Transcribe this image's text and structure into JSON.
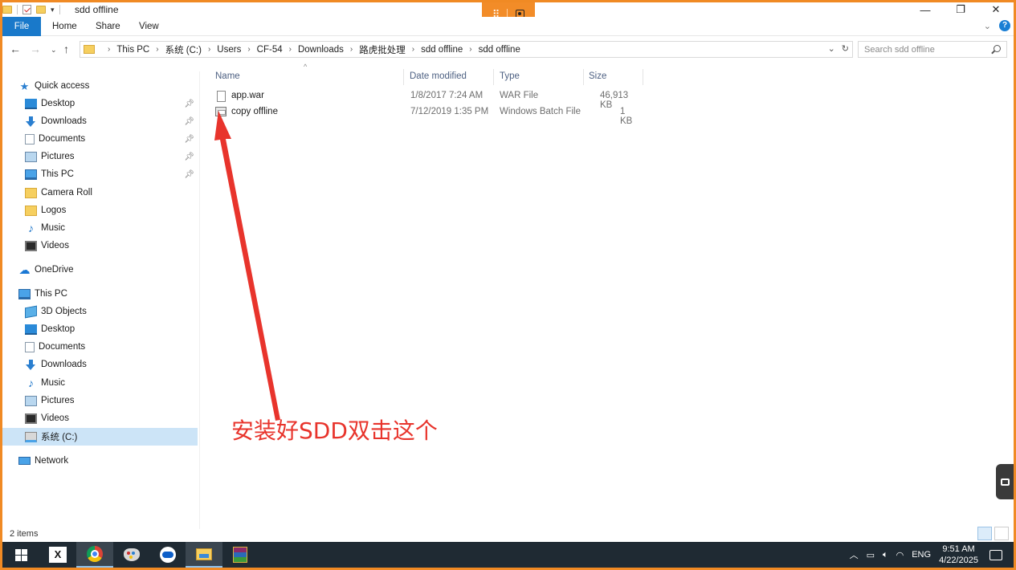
{
  "window": {
    "title": "sdd offline"
  },
  "ribbon": {
    "tabs": [
      "File",
      "Home",
      "Share",
      "View"
    ]
  },
  "address": {
    "breadcrumbs": [
      "This PC",
      "系统 (C:)",
      "Users",
      "CF-54",
      "Downloads",
      "路虎批处理",
      "sdd offline",
      "sdd offline"
    ],
    "search_placeholder": "Search sdd offline"
  },
  "nav": {
    "items": [
      {
        "label": "Quick access",
        "icon": "star-icon",
        "pinned": false
      },
      {
        "label": "Desktop",
        "icon": "desktop-icon",
        "pinned": true
      },
      {
        "label": "Downloads",
        "icon": "download-icon",
        "pinned": true
      },
      {
        "label": "Documents",
        "icon": "document-icon",
        "pinned": true
      },
      {
        "label": "Pictures",
        "icon": "pictures-icon",
        "pinned": true
      },
      {
        "label": "This PC",
        "icon": "pc-icon",
        "pinned": true
      },
      {
        "label": "Camera Roll",
        "icon": "folder-icon",
        "pinned": false
      },
      {
        "label": "Logos",
        "icon": "folder-icon",
        "pinned": false
      },
      {
        "label": "Music",
        "icon": "music-icon",
        "pinned": false
      },
      {
        "label": "Videos",
        "icon": "video-icon",
        "pinned": false
      },
      {
        "label": "OneDrive",
        "icon": "cloud-icon",
        "pinned": false
      },
      {
        "label": "This PC",
        "icon": "pc-icon",
        "pinned": false
      },
      {
        "label": "3D Objects",
        "icon": "3d-objects-icon",
        "pinned": false
      },
      {
        "label": "Desktop",
        "icon": "desktop-icon",
        "pinned": false
      },
      {
        "label": "Documents",
        "icon": "document-icon",
        "pinned": false
      },
      {
        "label": "Downloads",
        "icon": "download-icon",
        "pinned": false
      },
      {
        "label": "Music",
        "icon": "music-icon",
        "pinned": false
      },
      {
        "label": "Pictures",
        "icon": "pictures-icon",
        "pinned": false
      },
      {
        "label": "Videos",
        "icon": "video-icon",
        "pinned": false
      },
      {
        "label": "系统 (C:)",
        "icon": "drive-icon",
        "pinned": false,
        "selected": true
      },
      {
        "label": "Network",
        "icon": "network-icon",
        "pinned": false
      }
    ]
  },
  "files": {
    "columns": [
      "Name",
      "Date modified",
      "Type",
      "Size"
    ],
    "rows": [
      {
        "name": "app.war",
        "date": "1/8/2017 7:24 AM",
        "type": "WAR File",
        "size": "46,913 KB",
        "icon": "file-icon"
      },
      {
        "name": "copy offline",
        "date": "7/12/2019 1:35 PM",
        "type": "Windows Batch File",
        "size": "1 KB",
        "icon": "batch-file-icon"
      }
    ]
  },
  "annotation": {
    "text": "安装好SDD双击这个",
    "color": "#e8342c"
  },
  "status": {
    "item_count": "2 items"
  },
  "taskbar": {
    "apps": [
      "windows-start-icon",
      "x-app-icon",
      "chrome-icon",
      "paint-icon",
      "teamviewer-icon",
      "file-explorer-icon",
      "winrar-icon"
    ],
    "tray": {
      "language": "ENG",
      "time": "9:51 AM",
      "date": "4/22/2025"
    }
  },
  "colors": {
    "frame": "#f08a24",
    "file_tab": "#1979ca",
    "selected_nav": "#cce4f7",
    "taskbar": "#1f2a33"
  }
}
